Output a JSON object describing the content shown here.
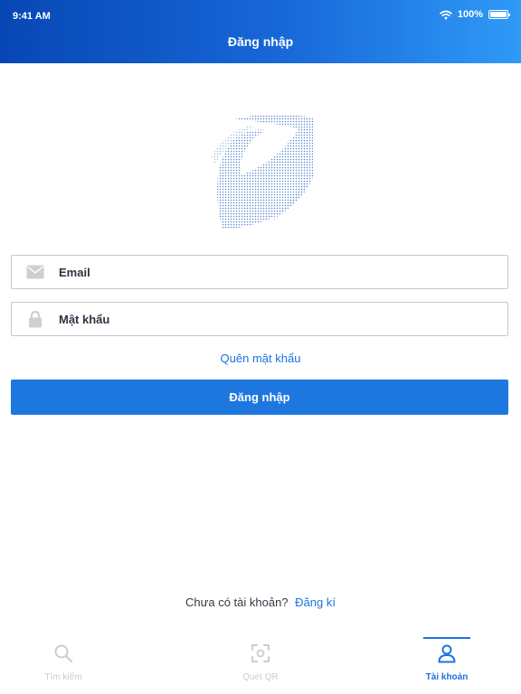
{
  "status_bar": {
    "time": "9:41 AM",
    "battery": "100%"
  },
  "header": {
    "title": "Đăng nhập"
  },
  "form": {
    "email_placeholder": "Email",
    "email_value": "",
    "password_placeholder": "Mật khẩu",
    "password_value": "",
    "forgot_password": "Quên mật khẩu",
    "login_button": "Đăng nhập"
  },
  "register": {
    "prompt": "Chưa có tài khoản?",
    "link": "Đăng kí"
  },
  "tabs": [
    {
      "label": "Tìm kiếm",
      "icon": "search-icon",
      "active": false
    },
    {
      "label": "Quét QR",
      "icon": "qr-scan-icon",
      "active": false
    },
    {
      "label": "Tài khoản",
      "icon": "user-icon",
      "active": true
    }
  ],
  "colors": {
    "primary": "#1e77df",
    "header_start": "#0747b5",
    "header_end": "#2f9af7",
    "inactive_tab": "#c9cdd2"
  }
}
